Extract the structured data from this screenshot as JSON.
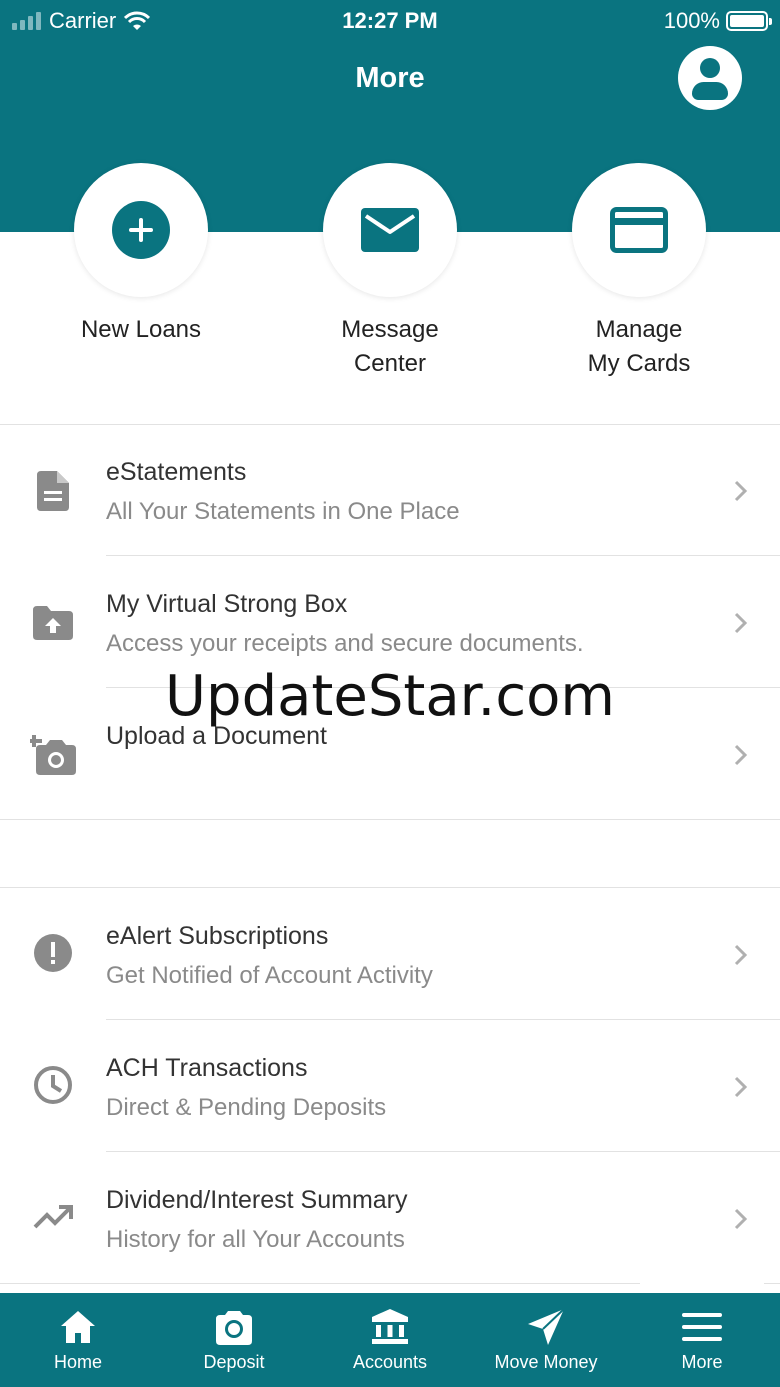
{
  "status_bar": {
    "carrier": "Carrier",
    "time": "12:27 PM",
    "battery": "100%"
  },
  "header": {
    "title": "More",
    "profile_icon": "person-icon",
    "bg_color": "#0a7480"
  },
  "quick_actions": [
    {
      "label": "New Loans",
      "icon": "plus-circle-icon"
    },
    {
      "label": "Message\nCenter",
      "icon": "envelope-icon"
    },
    {
      "label": "Manage\nMy Cards",
      "icon": "credit-card-icon"
    }
  ],
  "menu_group_1": [
    {
      "title": "eStatements",
      "subtitle": "All Your Statements in One Place",
      "icon": "document-icon"
    },
    {
      "title": "My Virtual Strong Box",
      "subtitle": "Access your receipts and secure documents.",
      "icon": "folder-upload-icon"
    },
    {
      "title": "Upload a Document",
      "subtitle": "",
      "icon": "add-camera-icon"
    }
  ],
  "menu_group_2": [
    {
      "title": "eAlert Subscriptions",
      "subtitle": "Get Notified of Account Activity",
      "icon": "alert-icon"
    },
    {
      "title": "ACH Transactions",
      "subtitle": "Direct & Pending Deposits",
      "icon": "clock-icon"
    },
    {
      "title": "Dividend/Interest Summary",
      "subtitle": "History for all Your Accounts",
      "icon": "trending-up-icon"
    }
  ],
  "watermark": "UpdateStar.com",
  "tabbar": [
    {
      "label": "Home",
      "icon": "home-icon"
    },
    {
      "label": "Deposit",
      "icon": "camera-icon"
    },
    {
      "label": "Accounts",
      "icon": "bank-icon"
    },
    {
      "label": "Move Money",
      "icon": "send-icon"
    },
    {
      "label": "More",
      "icon": "menu-icon",
      "selected": true
    }
  ]
}
